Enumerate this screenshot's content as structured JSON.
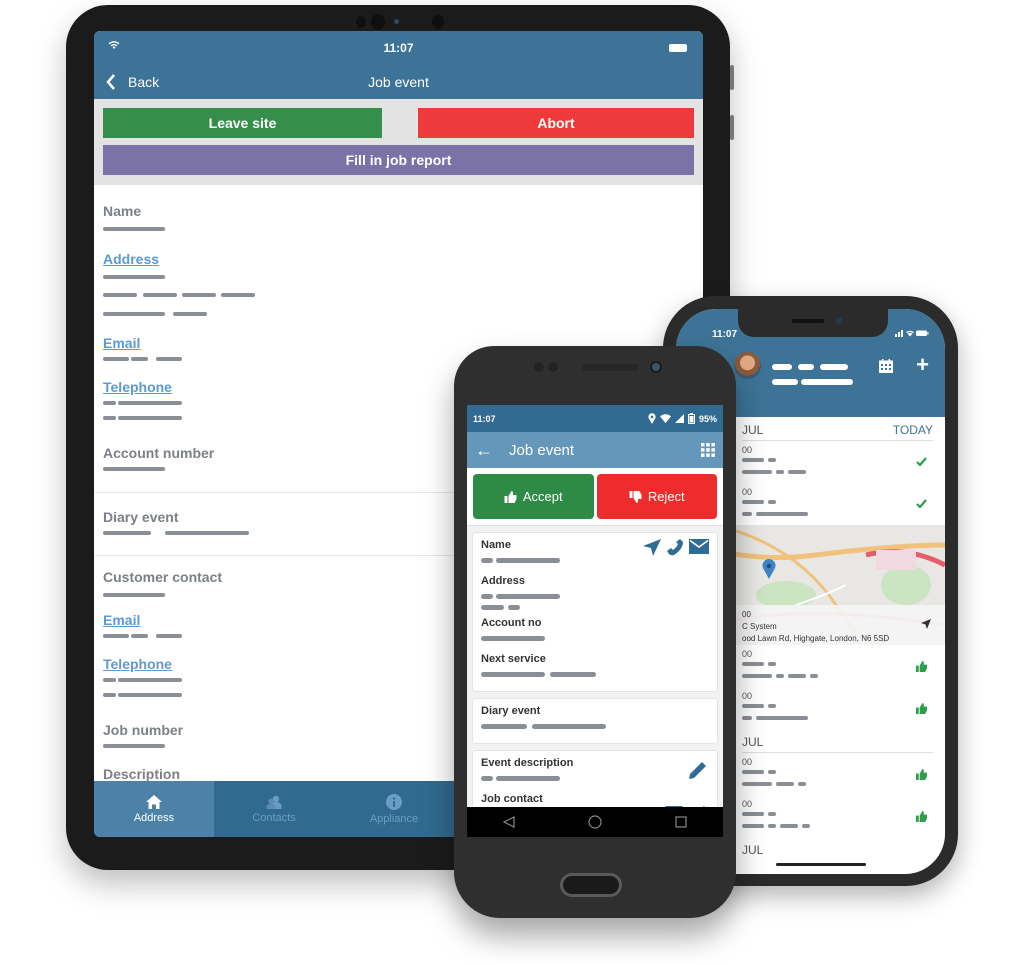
{
  "tablet": {
    "status": {
      "time": "11:07"
    },
    "nav": {
      "back_label": "Back",
      "title": "Job event"
    },
    "actions": {
      "leave_site": "Leave site",
      "abort": "Abort",
      "fill_report": "Fill in job report"
    },
    "fields": {
      "name": "Name",
      "address": "Address",
      "email": "Email",
      "telephone": "Telephone",
      "account_number": "Account number",
      "diary_event": "Diary event",
      "customer_contact": "Customer contact",
      "email2": "Email",
      "telephone2": "Telephone",
      "job_number": "Job number",
      "description": "Description"
    },
    "tabs": [
      {
        "label": "Address",
        "icon": "home-icon"
      },
      {
        "label": "Contacts",
        "icon": "contacts-icon"
      },
      {
        "label": "Appliance",
        "icon": "info-icon"
      }
    ],
    "colors": {
      "header": "#3d7396",
      "leave": "#358f4b",
      "abort": "#ee3a3a",
      "report": "#7b73a8",
      "link": "#5b9bd1"
    }
  },
  "android": {
    "status": {
      "time": "11:07",
      "battery": "95%"
    },
    "toolbar": {
      "title": "Job event"
    },
    "actions": {
      "accept": "Accept",
      "reject": "Reject"
    },
    "card1": {
      "name": "Name",
      "address": "Address",
      "account_no": "Account no",
      "next_service": "Next service"
    },
    "card2": {
      "diary_event": "Diary event"
    },
    "card3": {
      "event_description": "Event description",
      "job_contact": "Job contact"
    },
    "colors": {
      "accept": "#2e8b45",
      "reject": "#ee2c2c",
      "toolbar": "#6497b9"
    }
  },
  "iphone": {
    "status": {
      "time": "11:07"
    },
    "list": {
      "month1": "JUL",
      "today": "TODAY",
      "time_fragment": "00",
      "map_event": {
        "title": "C System",
        "address": "ood Lawn Rd, Highgate, London, N6 5SD"
      },
      "month2": "JUL",
      "month3": "JUL"
    }
  }
}
